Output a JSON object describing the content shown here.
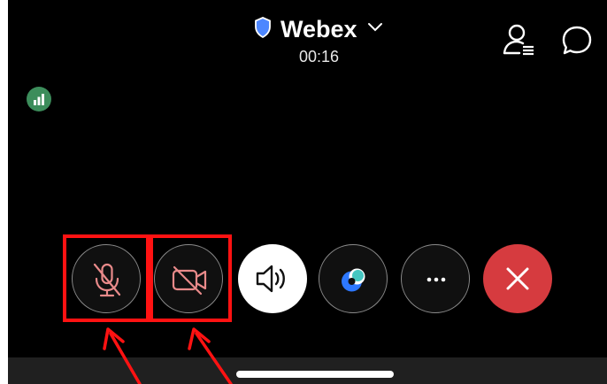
{
  "header": {
    "app_title": "Webex",
    "duration": "00:16"
  },
  "icons": {
    "shield": "shield-icon",
    "chevron": "chevron-down-icon",
    "participants": "participants-icon",
    "chat": "chat-bubble-icon",
    "signal": "signal-strength-icon",
    "mute": "microphone-muted-icon",
    "video": "video-off-icon",
    "speaker": "speaker-icon",
    "effects": "background-effects-icon",
    "more": "more-dots-icon",
    "end": "close-x-icon"
  },
  "controls": [
    "mute",
    "stop-video",
    "speaker",
    "effects",
    "more",
    "end-call"
  ],
  "colors": {
    "background": "#000000",
    "end_call": "#d63b3f",
    "muted_icon": "#e98a8a",
    "signal_badge": "#3c8d5b",
    "shield": "#4d87ff",
    "annotation": "#ff1212"
  }
}
